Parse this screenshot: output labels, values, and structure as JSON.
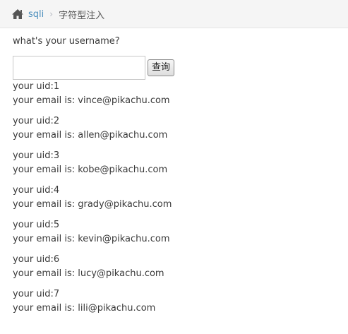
{
  "breadcrumb": {
    "home_icon": "home-icon",
    "link_label": "sqli",
    "separator": "›",
    "current_label": "字符型注入"
  },
  "form": {
    "question": "what's your username?",
    "input_value": "",
    "input_placeholder": "",
    "button_label": "查询"
  },
  "results": [
    {
      "uid_line": "your uid:1",
      "email_line": "your email is: vince@pikachu.com"
    },
    {
      "uid_line": "your uid:2",
      "email_line": "your email is: allen@pikachu.com"
    },
    {
      "uid_line": "your uid:3",
      "email_line": "your email is: kobe@pikachu.com"
    },
    {
      "uid_line": "your uid:4",
      "email_line": "your email is: grady@pikachu.com"
    },
    {
      "uid_line": "your uid:5",
      "email_line": "your email is: kevin@pikachu.com"
    },
    {
      "uid_line": "your uid:6",
      "email_line": "your email is: lucy@pikachu.com"
    },
    {
      "uid_line": "your uid:7",
      "email_line": "your email is: lili@pikachu.com"
    }
  ],
  "colors": {
    "link": "#4c8fbd",
    "text": "#393939",
    "topbar_bg": "#f5f5f5"
  }
}
